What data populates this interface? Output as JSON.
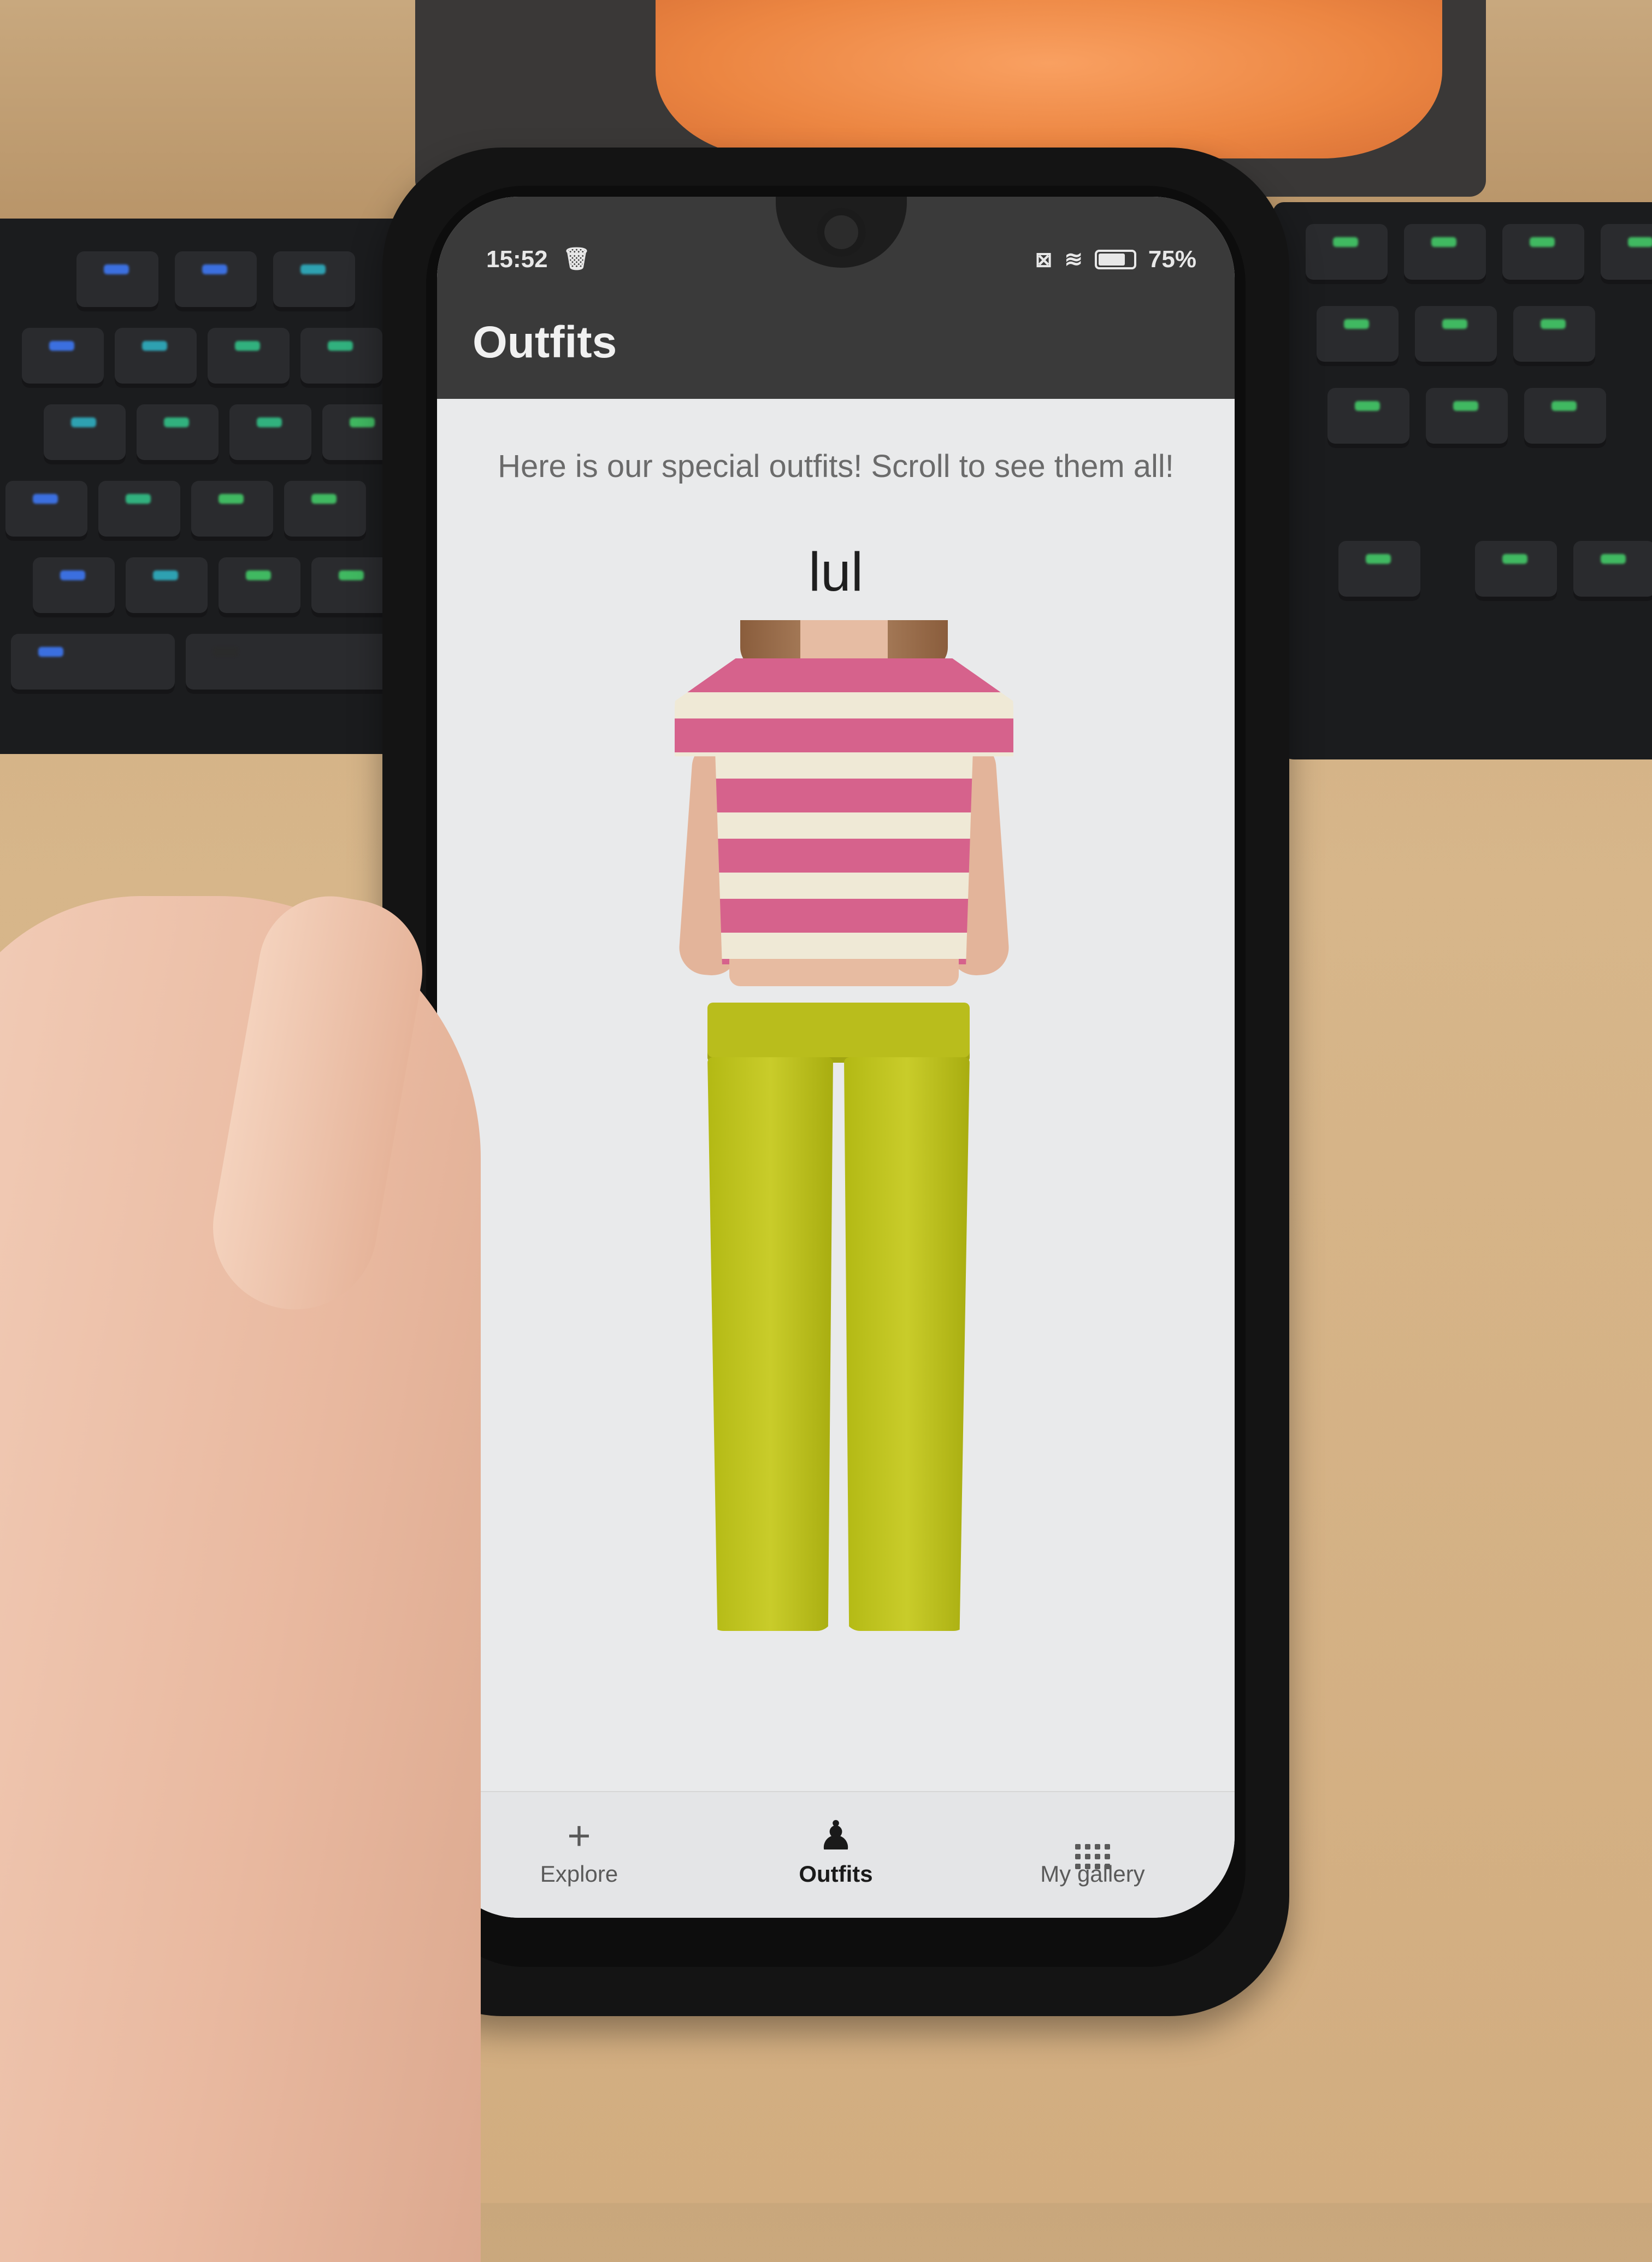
{
  "status_bar": {
    "time": "15:52",
    "battery": "75%"
  },
  "app_bar": {
    "title": "Outfits"
  },
  "content": {
    "subtitle": "Here is our special outfits! Scroll to see them all!",
    "outfit_name": "lul"
  },
  "bottom_nav": {
    "items": [
      {
        "label": "Explore",
        "icon": "plus-icon"
      },
      {
        "label": "Outfits",
        "icon": "outfit-icon",
        "active": true
      },
      {
        "label": "My gallery",
        "icon": "grid-icon"
      }
    ]
  },
  "colors": {
    "app_bar": "#3a3a3a",
    "screen_bg": "#e9eaeb",
    "shirt_pink": "#d6628c",
    "shirt_cream": "#efe9d6",
    "pants_lime": "#b9bd1c"
  }
}
